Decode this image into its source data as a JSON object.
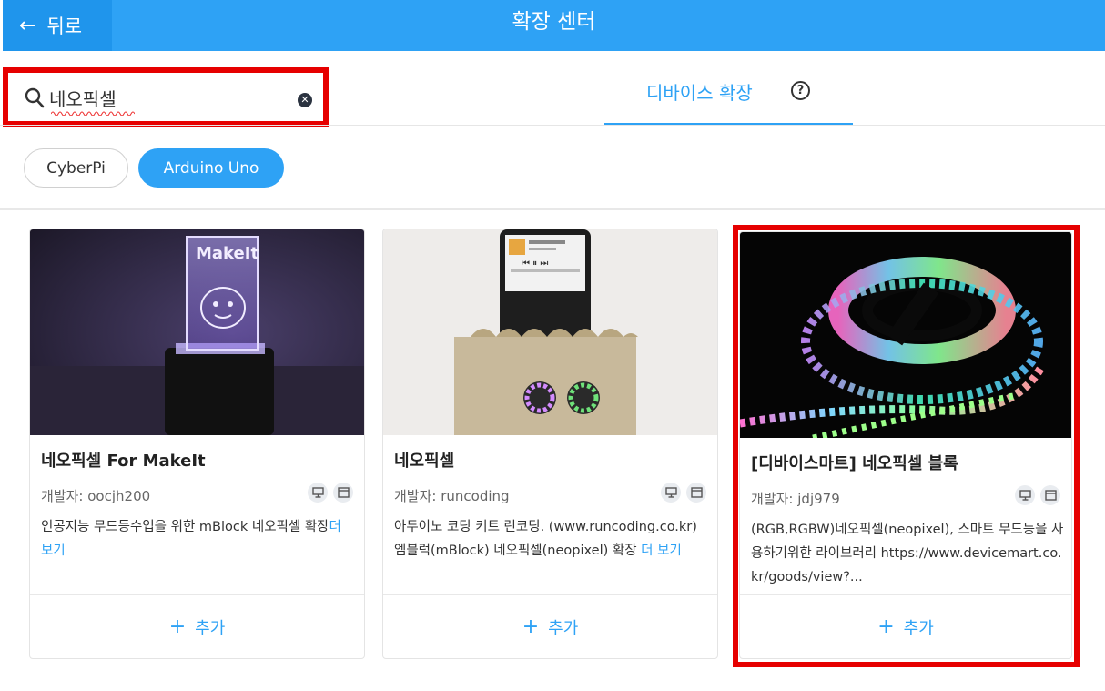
{
  "header": {
    "back_label": "뒤로",
    "title": "확장 센터"
  },
  "search": {
    "value": "네오픽셀"
  },
  "tabs": [
    {
      "label": "디바이스 확장",
      "active": true
    }
  ],
  "filters": [
    {
      "label": "CyberPi",
      "selected": false
    },
    {
      "label": "Arduino Uno",
      "selected": true
    }
  ],
  "cards": [
    {
      "title": "네오픽셀 For MakeIt",
      "developer_label": "개발자:",
      "developer": "oocjh200",
      "description": "인공지능 무드등수업을 위한 mBlock 네오픽셀 확장",
      "more_label": "더 보기",
      "add_label": "추가",
      "icons": [
        "desktop-icon",
        "browser-icon"
      ]
    },
    {
      "title": "네오픽셀",
      "developer_label": "개발자:",
      "developer": "runcoding",
      "description": "아두이노 코딩 키트 런코딩. (www.runcoding.co.kr) 엠블럭(mBlock) 네오픽셀(neopixel) 확장",
      "more_label": "더 보기",
      "add_label": "추가",
      "icons": [
        "desktop-icon",
        "browser-icon"
      ]
    },
    {
      "title": "[디바이스마트] 네오픽셀 블록",
      "developer_label": "개발자:",
      "developer": "jdj979",
      "description": "(RGB,RGBW)네오픽셀(neopixel), 스마트 무드등을 사용하기위한 라이브러리 https://www.devicemart.co.kr/goods/view?...",
      "add_label": "추가",
      "icons": [
        "desktop-icon",
        "browser-icon"
      ]
    }
  ],
  "colors": {
    "accent": "#2ea2f5",
    "highlight": "#e60000"
  }
}
